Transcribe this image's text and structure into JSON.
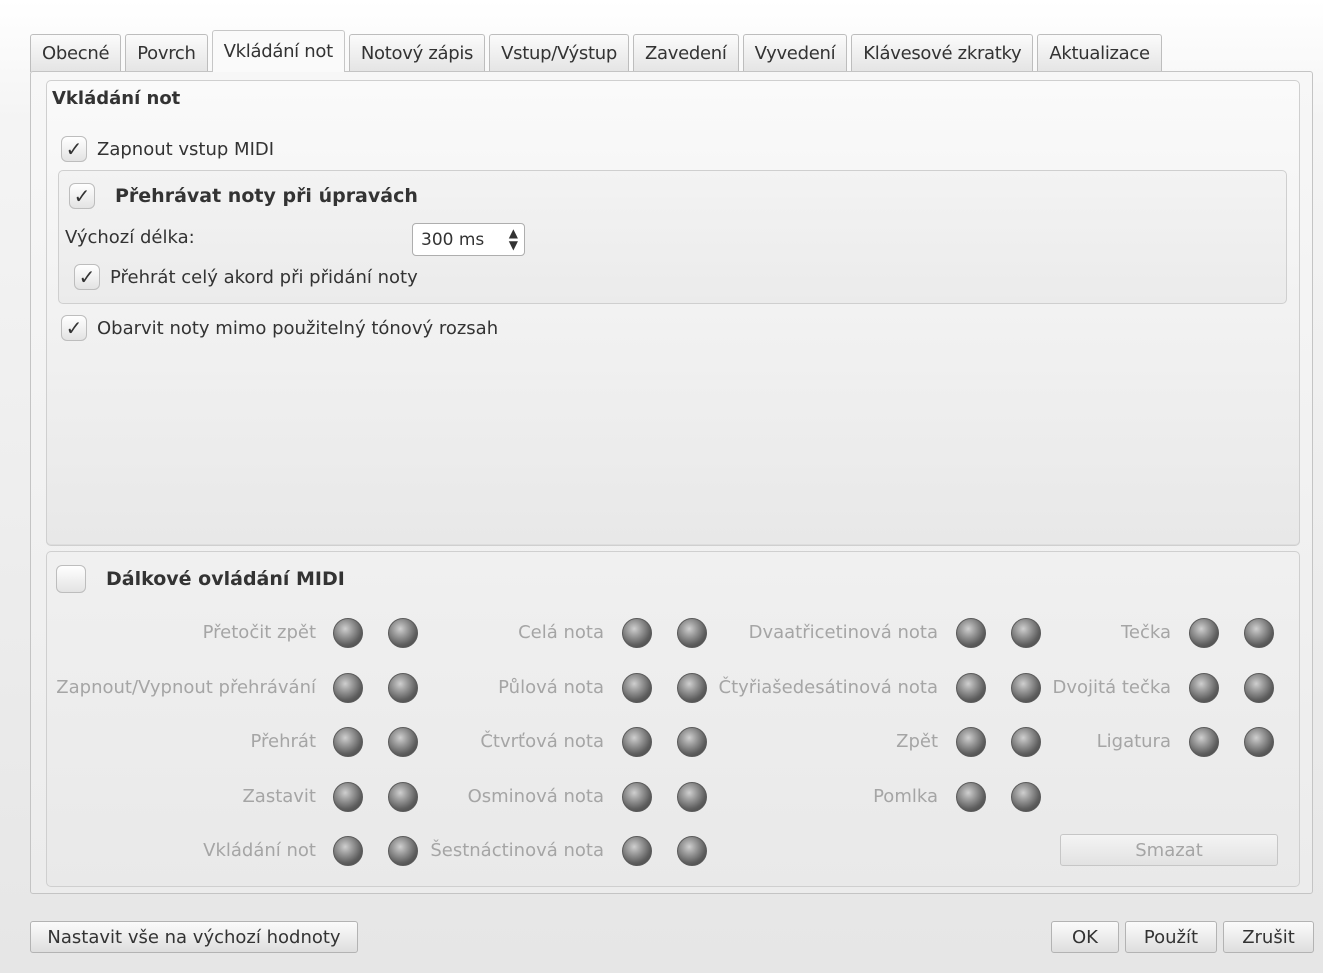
{
  "tabs": [
    "Obecné",
    "Povrch",
    "Vkládání not",
    "Notový zápis",
    "Vstup/Výstup",
    "Zavedení",
    "Vyvedení",
    "Klávesové zkratky",
    "Aktualizace"
  ],
  "active_tab_index": 2,
  "note_input": {
    "title": "Vkládání not",
    "enable_midi_label": "Zapnout vstup MIDI",
    "enable_midi_checked": true,
    "playback": {
      "title": "Přehrávat noty při úpravách",
      "checked": true,
      "default_length_label": "Výchozí délka:",
      "default_length_value": "300 ms",
      "play_chord_label": "Přehrát celý akord při přidání noty",
      "play_chord_checked": true
    },
    "color_out_of_range_label": "Obarvit noty mimo použitelný tónový rozsah",
    "color_out_of_range_checked": true
  },
  "midi_remote": {
    "title": "Dálkové ovládání MIDI",
    "checked": false,
    "columns": [
      [
        "Přetočit zpět",
        "Zapnout/Vypnout přehrávání",
        "Přehrát",
        "Zastavit",
        "Vkládání not"
      ],
      [
        "Celá nota",
        "Půlová nota",
        "Čtvrťová nota",
        "Osminová nota",
        "Šestnáctinová nota"
      ],
      [
        "Dvaatřicetinová nota",
        "Čtyřiašedesátinová nota",
        "Zpět",
        "Pomlka"
      ],
      [
        "Tečka",
        "Dvojitá tečka",
        "Ligatura"
      ]
    ],
    "clear_label": "Smazat"
  },
  "buttons": {
    "reset_all": "Nastavit vše na výchozí hodnoty",
    "ok": "OK",
    "apply": "Použít",
    "cancel": "Zrušit"
  },
  "icons": {
    "check": "check-icon",
    "spin": "spin-arrows-icon",
    "led": "midi-led-icon"
  }
}
